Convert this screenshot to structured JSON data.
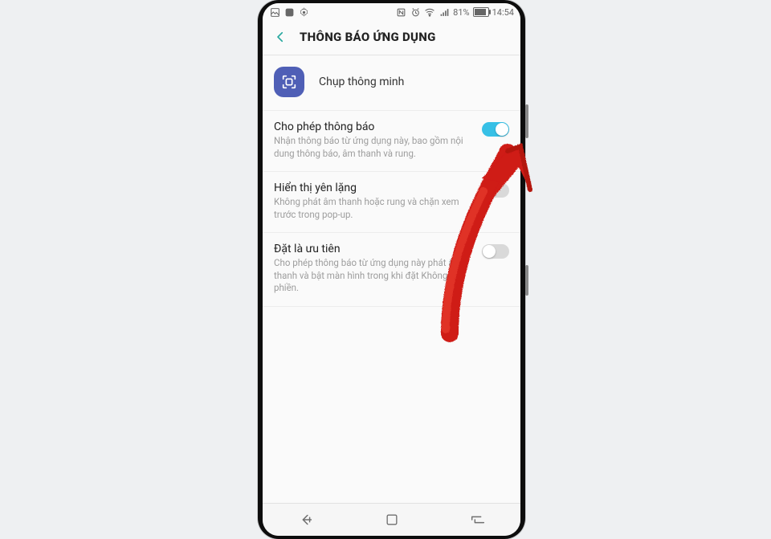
{
  "status": {
    "battery_pct": "81%",
    "time": "14:54"
  },
  "header": {
    "title": "THÔNG BÁO ỨNG DỤNG"
  },
  "app": {
    "name": "Chụp thông minh"
  },
  "settings": [
    {
      "title": "Cho phép thông báo",
      "desc": "Nhận thông báo từ ứng dụng này, bao gồm nội dung thông báo, âm thanh và rung.",
      "on": true
    },
    {
      "title": "Hiển thị yên lặng",
      "desc": "Không phát âm thanh hoặc rung và chặn xem trước trong pop-up.",
      "on": false
    },
    {
      "title": "Đặt là ưu tiên",
      "desc": "Cho phép thông báo từ ứng dụng này phát âm thanh và bật màn hình trong khi đặt Không làm phiền.",
      "on": false
    }
  ]
}
